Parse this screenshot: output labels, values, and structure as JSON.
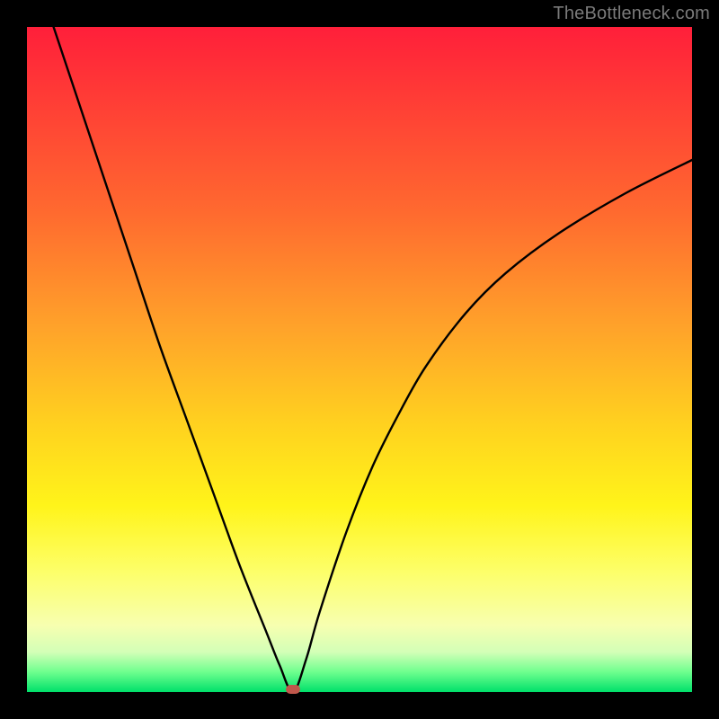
{
  "watermark": "TheBottleneck.com",
  "chart_data": {
    "type": "line",
    "title": "",
    "xlabel": "",
    "ylabel": "",
    "xlim": [
      0,
      100
    ],
    "ylim": [
      0,
      100
    ],
    "background": {
      "gradient_top_color": "#ff1f3a",
      "gradient_bottom_color": "#00e06a",
      "meaning": "red=high bottleneck, green=low bottleneck"
    },
    "series": [
      {
        "name": "bottleneck-curve",
        "x": [
          4,
          8,
          12,
          16,
          20,
          24,
          28,
          32,
          36,
          38,
          40,
          42,
          44,
          48,
          52,
          56,
          60,
          66,
          72,
          80,
          90,
          100
        ],
        "values": [
          100,
          88,
          76,
          64,
          52,
          41,
          30,
          19,
          9,
          4,
          0,
          5,
          12,
          24,
          34,
          42,
          49,
          57,
          63,
          69,
          75,
          80
        ]
      }
    ],
    "marker": {
      "x": 40,
      "y": 0,
      "color": "#c0574b"
    },
    "annotations": []
  }
}
